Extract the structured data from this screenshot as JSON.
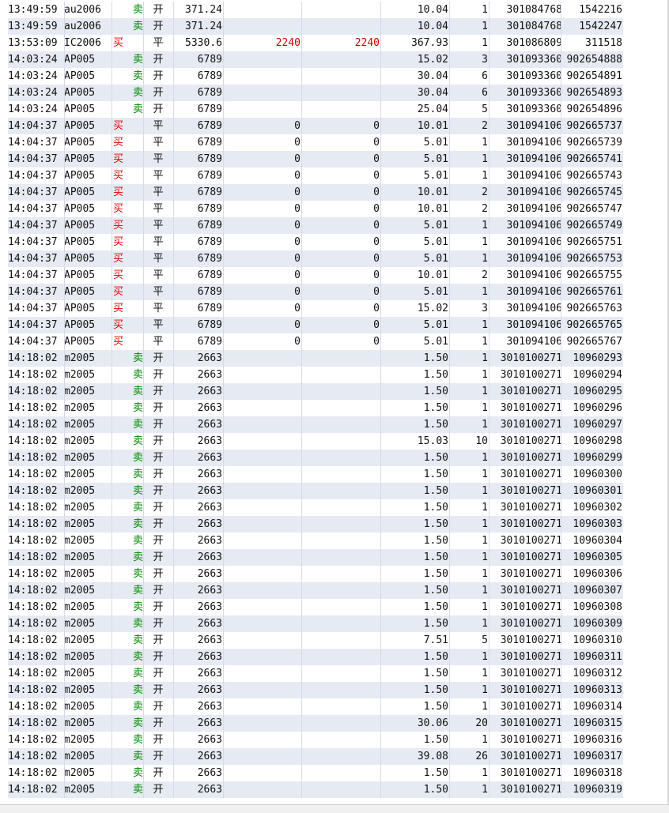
{
  "colors": {
    "buy": "#e00000",
    "sell": "#008800",
    "alt_row": "#e6eaf2",
    "highlight": "#d00000"
  },
  "rows": [
    {
      "time": "13:49:59",
      "code": "au2006",
      "dir": "卖",
      "dir_type": "sell",
      "oc": "开",
      "price": "371.24",
      "p1": "",
      "p2": "",
      "amount": "10.04",
      "qty": "1",
      "trade": "301084768",
      "order": "1542216",
      "p_red": false
    },
    {
      "time": "13:49:59",
      "code": "au2006",
      "dir": "卖",
      "dir_type": "sell",
      "oc": "开",
      "price": "371.24",
      "p1": "",
      "p2": "",
      "amount": "10.04",
      "qty": "1",
      "trade": "301084768",
      "order": "1542247",
      "p_red": false
    },
    {
      "time": "13:53:09",
      "code": "IC2006",
      "dir": "买",
      "dir_type": "buy",
      "oc": "平",
      "price": "5330.6",
      "p1": "2240",
      "p2": "2240",
      "amount": "367.93",
      "qty": "1",
      "trade": "301086809",
      "order": "311518",
      "p_red": true
    },
    {
      "time": "14:03:24",
      "code": "AP005",
      "dir": "卖",
      "dir_type": "sell",
      "oc": "开",
      "price": "6789",
      "p1": "",
      "p2": "",
      "amount": "15.02",
      "qty": "3",
      "trade": "301093360",
      "order": "902654888",
      "p_red": false
    },
    {
      "time": "14:03:24",
      "code": "AP005",
      "dir": "卖",
      "dir_type": "sell",
      "oc": "开",
      "price": "6789",
      "p1": "",
      "p2": "",
      "amount": "30.04",
      "qty": "6",
      "trade": "301093360",
      "order": "902654891",
      "p_red": false
    },
    {
      "time": "14:03:24",
      "code": "AP005",
      "dir": "卖",
      "dir_type": "sell",
      "oc": "开",
      "price": "6789",
      "p1": "",
      "p2": "",
      "amount": "30.04",
      "qty": "6",
      "trade": "301093360",
      "order": "902654893",
      "p_red": false
    },
    {
      "time": "14:03:24",
      "code": "AP005",
      "dir": "卖",
      "dir_type": "sell",
      "oc": "开",
      "price": "6789",
      "p1": "",
      "p2": "",
      "amount": "25.04",
      "qty": "5",
      "trade": "301093360",
      "order": "902654896",
      "p_red": false
    },
    {
      "time": "14:04:37",
      "code": "AP005",
      "dir": "买",
      "dir_type": "buy",
      "oc": "平",
      "price": "6789",
      "p1": "0",
      "p2": "0",
      "amount": "10.01",
      "qty": "2",
      "trade": "301094106",
      "order": "902665737",
      "p_red": false
    },
    {
      "time": "14:04:37",
      "code": "AP005",
      "dir": "买",
      "dir_type": "buy",
      "oc": "平",
      "price": "6789",
      "p1": "0",
      "p2": "0",
      "amount": "5.01",
      "qty": "1",
      "trade": "301094106",
      "order": "902665739",
      "p_red": false
    },
    {
      "time": "14:04:37",
      "code": "AP005",
      "dir": "买",
      "dir_type": "buy",
      "oc": "平",
      "price": "6789",
      "p1": "0",
      "p2": "0",
      "amount": "5.01",
      "qty": "1",
      "trade": "301094106",
      "order": "902665741",
      "p_red": false
    },
    {
      "time": "14:04:37",
      "code": "AP005",
      "dir": "买",
      "dir_type": "buy",
      "oc": "平",
      "price": "6789",
      "p1": "0",
      "p2": "0",
      "amount": "5.01",
      "qty": "1",
      "trade": "301094106",
      "order": "902665743",
      "p_red": false
    },
    {
      "time": "14:04:37",
      "code": "AP005",
      "dir": "买",
      "dir_type": "buy",
      "oc": "平",
      "price": "6789",
      "p1": "0",
      "p2": "0",
      "amount": "10.01",
      "qty": "2",
      "trade": "301094106",
      "order": "902665745",
      "p_red": false
    },
    {
      "time": "14:04:37",
      "code": "AP005",
      "dir": "买",
      "dir_type": "buy",
      "oc": "平",
      "price": "6789",
      "p1": "0",
      "p2": "0",
      "amount": "10.01",
      "qty": "2",
      "trade": "301094106",
      "order": "902665747",
      "p_red": false
    },
    {
      "time": "14:04:37",
      "code": "AP005",
      "dir": "买",
      "dir_type": "buy",
      "oc": "平",
      "price": "6789",
      "p1": "0",
      "p2": "0",
      "amount": "5.01",
      "qty": "1",
      "trade": "301094106",
      "order": "902665749",
      "p_red": false
    },
    {
      "time": "14:04:37",
      "code": "AP005",
      "dir": "买",
      "dir_type": "buy",
      "oc": "平",
      "price": "6789",
      "p1": "0",
      "p2": "0",
      "amount": "5.01",
      "qty": "1",
      "trade": "301094106",
      "order": "902665751",
      "p_red": false
    },
    {
      "time": "14:04:37",
      "code": "AP005",
      "dir": "买",
      "dir_type": "buy",
      "oc": "平",
      "price": "6789",
      "p1": "0",
      "p2": "0",
      "amount": "5.01",
      "qty": "1",
      "trade": "301094106",
      "order": "902665753",
      "p_red": false
    },
    {
      "time": "14:04:37",
      "code": "AP005",
      "dir": "买",
      "dir_type": "buy",
      "oc": "平",
      "price": "6789",
      "p1": "0",
      "p2": "0",
      "amount": "10.01",
      "qty": "2",
      "trade": "301094106",
      "order": "902665755",
      "p_red": false
    },
    {
      "time": "14:04:37",
      "code": "AP005",
      "dir": "买",
      "dir_type": "buy",
      "oc": "平",
      "price": "6789",
      "p1": "0",
      "p2": "0",
      "amount": "5.01",
      "qty": "1",
      "trade": "301094106",
      "order": "902665761",
      "p_red": false
    },
    {
      "time": "14:04:37",
      "code": "AP005",
      "dir": "买",
      "dir_type": "buy",
      "oc": "平",
      "price": "6789",
      "p1": "0",
      "p2": "0",
      "amount": "15.02",
      "qty": "3",
      "trade": "301094106",
      "order": "902665763",
      "p_red": false
    },
    {
      "time": "14:04:37",
      "code": "AP005",
      "dir": "买",
      "dir_type": "buy",
      "oc": "平",
      "price": "6789",
      "p1": "0",
      "p2": "0",
      "amount": "5.01",
      "qty": "1",
      "trade": "301094106",
      "order": "902665765",
      "p_red": false
    },
    {
      "time": "14:04:37",
      "code": "AP005",
      "dir": "买",
      "dir_type": "buy",
      "oc": "平",
      "price": "6789",
      "p1": "0",
      "p2": "0",
      "amount": "5.01",
      "qty": "1",
      "trade": "301094106",
      "order": "902665767",
      "p_red": false
    },
    {
      "time": "14:18:02",
      "code": "m2005",
      "dir": "卖",
      "dir_type": "sell",
      "oc": "开",
      "price": "2663",
      "p1": "",
      "p2": "",
      "amount": "1.50",
      "qty": "1",
      "trade": "3010100271",
      "order": "10960293",
      "p_red": false
    },
    {
      "time": "14:18:02",
      "code": "m2005",
      "dir": "卖",
      "dir_type": "sell",
      "oc": "开",
      "price": "2663",
      "p1": "",
      "p2": "",
      "amount": "1.50",
      "qty": "1",
      "trade": "3010100271",
      "order": "10960294",
      "p_red": false
    },
    {
      "time": "14:18:02",
      "code": "m2005",
      "dir": "卖",
      "dir_type": "sell",
      "oc": "开",
      "price": "2663",
      "p1": "",
      "p2": "",
      "amount": "1.50",
      "qty": "1",
      "trade": "3010100271",
      "order": "10960295",
      "p_red": false
    },
    {
      "time": "14:18:02",
      "code": "m2005",
      "dir": "卖",
      "dir_type": "sell",
      "oc": "开",
      "price": "2663",
      "p1": "",
      "p2": "",
      "amount": "1.50",
      "qty": "1",
      "trade": "3010100271",
      "order": "10960296",
      "p_red": false
    },
    {
      "time": "14:18:02",
      "code": "m2005",
      "dir": "卖",
      "dir_type": "sell",
      "oc": "开",
      "price": "2663",
      "p1": "",
      "p2": "",
      "amount": "1.50",
      "qty": "1",
      "trade": "3010100271",
      "order": "10960297",
      "p_red": false
    },
    {
      "time": "14:18:02",
      "code": "m2005",
      "dir": "卖",
      "dir_type": "sell",
      "oc": "开",
      "price": "2663",
      "p1": "",
      "p2": "",
      "amount": "15.03",
      "qty": "10",
      "trade": "3010100271",
      "order": "10960298",
      "p_red": false
    },
    {
      "time": "14:18:02",
      "code": "m2005",
      "dir": "卖",
      "dir_type": "sell",
      "oc": "开",
      "price": "2663",
      "p1": "",
      "p2": "",
      "amount": "1.50",
      "qty": "1",
      "trade": "3010100271",
      "order": "10960299",
      "p_red": false
    },
    {
      "time": "14:18:02",
      "code": "m2005",
      "dir": "卖",
      "dir_type": "sell",
      "oc": "开",
      "price": "2663",
      "p1": "",
      "p2": "",
      "amount": "1.50",
      "qty": "1",
      "trade": "3010100271",
      "order": "10960300",
      "p_red": false
    },
    {
      "time": "14:18:02",
      "code": "m2005",
      "dir": "卖",
      "dir_type": "sell",
      "oc": "开",
      "price": "2663",
      "p1": "",
      "p2": "",
      "amount": "1.50",
      "qty": "1",
      "trade": "3010100271",
      "order": "10960301",
      "p_red": false
    },
    {
      "time": "14:18:02",
      "code": "m2005",
      "dir": "卖",
      "dir_type": "sell",
      "oc": "开",
      "price": "2663",
      "p1": "",
      "p2": "",
      "amount": "1.50",
      "qty": "1",
      "trade": "3010100271",
      "order": "10960302",
      "p_red": false
    },
    {
      "time": "14:18:02",
      "code": "m2005",
      "dir": "卖",
      "dir_type": "sell",
      "oc": "开",
      "price": "2663",
      "p1": "",
      "p2": "",
      "amount": "1.50",
      "qty": "1",
      "trade": "3010100271",
      "order": "10960303",
      "p_red": false
    },
    {
      "time": "14:18:02",
      "code": "m2005",
      "dir": "卖",
      "dir_type": "sell",
      "oc": "开",
      "price": "2663",
      "p1": "",
      "p2": "",
      "amount": "1.50",
      "qty": "1",
      "trade": "3010100271",
      "order": "10960304",
      "p_red": false
    },
    {
      "time": "14:18:02",
      "code": "m2005",
      "dir": "卖",
      "dir_type": "sell",
      "oc": "开",
      "price": "2663",
      "p1": "",
      "p2": "",
      "amount": "1.50",
      "qty": "1",
      "trade": "3010100271",
      "order": "10960305",
      "p_red": false
    },
    {
      "time": "14:18:02",
      "code": "m2005",
      "dir": "卖",
      "dir_type": "sell",
      "oc": "开",
      "price": "2663",
      "p1": "",
      "p2": "",
      "amount": "1.50",
      "qty": "1",
      "trade": "3010100271",
      "order": "10960306",
      "p_red": false
    },
    {
      "time": "14:18:02",
      "code": "m2005",
      "dir": "卖",
      "dir_type": "sell",
      "oc": "开",
      "price": "2663",
      "p1": "",
      "p2": "",
      "amount": "1.50",
      "qty": "1",
      "trade": "3010100271",
      "order": "10960307",
      "p_red": false
    },
    {
      "time": "14:18:02",
      "code": "m2005",
      "dir": "卖",
      "dir_type": "sell",
      "oc": "开",
      "price": "2663",
      "p1": "",
      "p2": "",
      "amount": "1.50",
      "qty": "1",
      "trade": "3010100271",
      "order": "10960308",
      "p_red": false
    },
    {
      "time": "14:18:02",
      "code": "m2005",
      "dir": "卖",
      "dir_type": "sell",
      "oc": "开",
      "price": "2663",
      "p1": "",
      "p2": "",
      "amount": "1.50",
      "qty": "1",
      "trade": "3010100271",
      "order": "10960309",
      "p_red": false
    },
    {
      "time": "14:18:02",
      "code": "m2005",
      "dir": "卖",
      "dir_type": "sell",
      "oc": "开",
      "price": "2663",
      "p1": "",
      "p2": "",
      "amount": "7.51",
      "qty": "5",
      "trade": "3010100271",
      "order": "10960310",
      "p_red": false
    },
    {
      "time": "14:18:02",
      "code": "m2005",
      "dir": "卖",
      "dir_type": "sell",
      "oc": "开",
      "price": "2663",
      "p1": "",
      "p2": "",
      "amount": "1.50",
      "qty": "1",
      "trade": "3010100271",
      "order": "10960311",
      "p_red": false
    },
    {
      "time": "14:18:02",
      "code": "m2005",
      "dir": "卖",
      "dir_type": "sell",
      "oc": "开",
      "price": "2663",
      "p1": "",
      "p2": "",
      "amount": "1.50",
      "qty": "1",
      "trade": "3010100271",
      "order": "10960312",
      "p_red": false
    },
    {
      "time": "14:18:02",
      "code": "m2005",
      "dir": "卖",
      "dir_type": "sell",
      "oc": "开",
      "price": "2663",
      "p1": "",
      "p2": "",
      "amount": "1.50",
      "qty": "1",
      "trade": "3010100271",
      "order": "10960313",
      "p_red": false
    },
    {
      "time": "14:18:02",
      "code": "m2005",
      "dir": "卖",
      "dir_type": "sell",
      "oc": "开",
      "price": "2663",
      "p1": "",
      "p2": "",
      "amount": "1.50",
      "qty": "1",
      "trade": "3010100271",
      "order": "10960314",
      "p_red": false
    },
    {
      "time": "14:18:02",
      "code": "m2005",
      "dir": "卖",
      "dir_type": "sell",
      "oc": "开",
      "price": "2663",
      "p1": "",
      "p2": "",
      "amount": "30.06",
      "qty": "20",
      "trade": "3010100271",
      "order": "10960315",
      "p_red": false
    },
    {
      "time": "14:18:02",
      "code": "m2005",
      "dir": "卖",
      "dir_type": "sell",
      "oc": "开",
      "price": "2663",
      "p1": "",
      "p2": "",
      "amount": "1.50",
      "qty": "1",
      "trade": "3010100271",
      "order": "10960316",
      "p_red": false
    },
    {
      "time": "14:18:02",
      "code": "m2005",
      "dir": "卖",
      "dir_type": "sell",
      "oc": "开",
      "price": "2663",
      "p1": "",
      "p2": "",
      "amount": "39.08",
      "qty": "26",
      "trade": "3010100271",
      "order": "10960317",
      "p_red": false
    },
    {
      "time": "14:18:02",
      "code": "m2005",
      "dir": "卖",
      "dir_type": "sell",
      "oc": "开",
      "price": "2663",
      "p1": "",
      "p2": "",
      "amount": "1.50",
      "qty": "1",
      "trade": "3010100271",
      "order": "10960318",
      "p_red": false
    },
    {
      "time": "14:18:02",
      "code": "m2005",
      "dir": "卖",
      "dir_type": "sell",
      "oc": "开",
      "price": "2663",
      "p1": "",
      "p2": "",
      "amount": "1.50",
      "qty": "1",
      "trade": "3010100271",
      "order": "10960319",
      "p_red": false
    }
  ]
}
